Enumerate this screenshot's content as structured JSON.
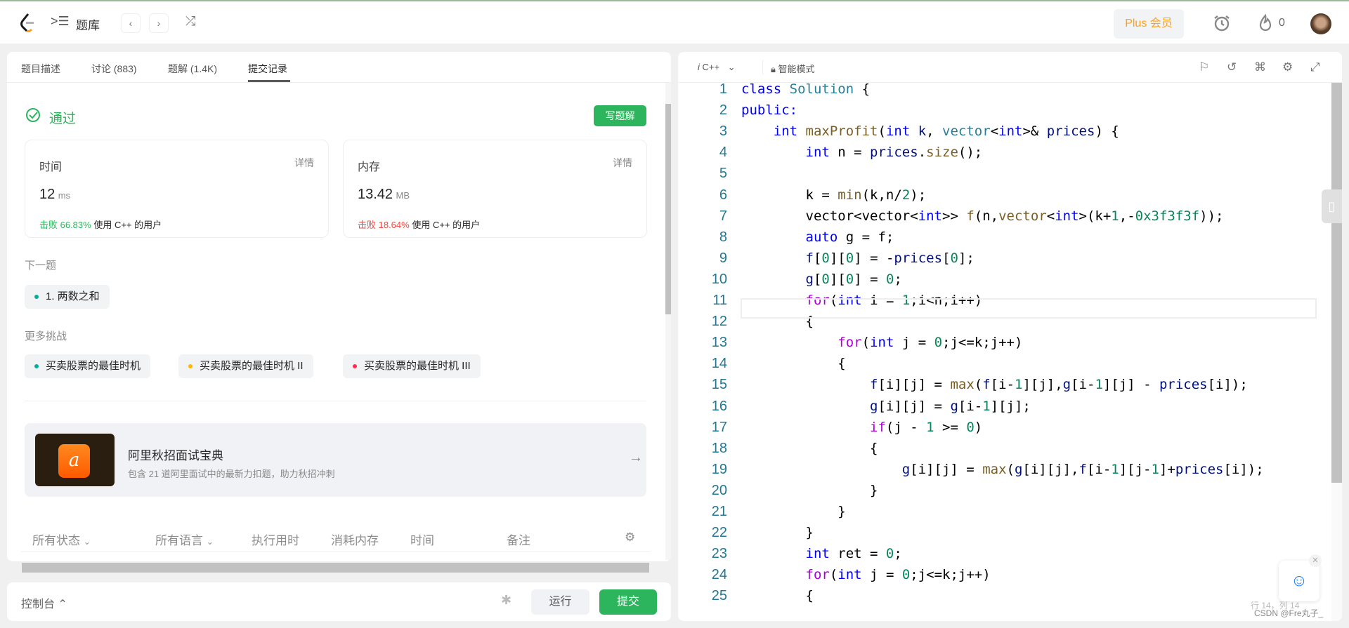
{
  "header": {
    "title": "题库",
    "prev": "‹",
    "next": "›",
    "plus_label": "Plus 会员",
    "streak": "0"
  },
  "left": {
    "tabs": [
      {
        "label": "题目描述"
      },
      {
        "label": "讨论 (883)"
      },
      {
        "label": "题解 (1.4K)"
      },
      {
        "label": "提交记录"
      }
    ],
    "status": "通过",
    "write_solution": "写题解",
    "time": {
      "title": "时间",
      "detail": "详情",
      "value": "12",
      "unit": "ms",
      "beat": "击败 66.83%",
      "suffix": "使用 C++ 的用户"
    },
    "memory": {
      "title": "内存",
      "detail": "详情",
      "value": "13.42",
      "unit": "MB",
      "beat": "击败 18.64%",
      "suffix": "使用 C++ 的用户"
    },
    "next_title": "下一题",
    "next_item": "1. 两数之和",
    "more_title": "更多挑战",
    "more_items": [
      {
        "label": "买卖股票的最佳时机",
        "color": "#00af9b"
      },
      {
        "label": "买卖股票的最佳时机 II",
        "color": "#ffb800"
      },
      {
        "label": "买卖股票的最佳时机 III",
        "color": "#ff2d55"
      }
    ],
    "promo": {
      "title": "阿里秋招面试宝典",
      "desc": "包含 21 道阿里面试中的最新力扣题，助力秋招冲刺"
    },
    "table_headers": [
      "所有状态",
      "所有语言",
      "执行用时",
      "消耗内存",
      "时间",
      "备注"
    ]
  },
  "bottom": {
    "console": "控制台",
    "run": "运行",
    "submit": "提交"
  },
  "editor": {
    "language": "C++",
    "mode": "智能模式",
    "cursor": "行 14，列 14",
    "watermark": "CSDN @Fre丸子_",
    "lines": [
      [
        [
          "class ",
          "kw"
        ],
        [
          "Solution",
          "ty"
        ],
        [
          " {",
          ""
        ]
      ],
      [
        [
          "public:",
          "kw"
        ]
      ],
      [
        [
          "    ",
          ""
        ],
        [
          "int ",
          "kw"
        ],
        [
          "maxProfit",
          "fn"
        ],
        [
          "(",
          ""
        ],
        [
          "int ",
          "kw"
        ],
        [
          "k",
          "var"
        ],
        [
          ", ",
          ""
        ],
        [
          "vector",
          "ty"
        ],
        [
          "<",
          ""
        ],
        [
          "int",
          "kw"
        ],
        [
          ">& ",
          ""
        ],
        [
          "prices",
          "var"
        ],
        [
          ") {",
          ""
        ]
      ],
      [
        [
          "        ",
          ""
        ],
        [
          "int ",
          "kw"
        ],
        [
          "n = ",
          ""
        ],
        [
          "prices",
          "var"
        ],
        [
          ".",
          ""
        ],
        [
          "size",
          "fn"
        ],
        [
          "();",
          ""
        ]
      ],
      [
        [
          "",
          ""
        ]
      ],
      [
        [
          "        k = ",
          ""
        ],
        [
          "min",
          "fn"
        ],
        [
          "(k,n/",
          ""
        ],
        [
          "2",
          "num"
        ],
        [
          ");",
          ""
        ]
      ],
      [
        [
          "        vector<vector<",
          ""
        ],
        [
          "int",
          "kw"
        ],
        [
          ">> ",
          ""
        ],
        [
          "f",
          "fn"
        ],
        [
          "(n,",
          ""
        ],
        [
          "vector",
          "fn"
        ],
        [
          "<",
          ""
        ],
        [
          "int",
          "kw"
        ],
        [
          ">(k+",
          ""
        ],
        [
          "1",
          "num"
        ],
        [
          ",-",
          ""
        ],
        [
          "0x3f3f3f",
          "num"
        ],
        [
          "));",
          ""
        ]
      ],
      [
        [
          "        ",
          ""
        ],
        [
          "auto ",
          "kw"
        ],
        [
          "g = f;",
          ""
        ]
      ],
      [
        [
          "        ",
          ""
        ],
        [
          "f",
          "var"
        ],
        [
          "[",
          ""
        ],
        [
          "0",
          "num"
        ],
        [
          "][",
          ""
        ],
        [
          "0",
          "num"
        ],
        [
          "] = -",
          ""
        ],
        [
          "prices",
          "var"
        ],
        [
          "[",
          ""
        ],
        [
          "0",
          "num"
        ],
        [
          "];",
          ""
        ]
      ],
      [
        [
          "        ",
          ""
        ],
        [
          "g",
          "var"
        ],
        [
          "[",
          ""
        ],
        [
          "0",
          "num"
        ],
        [
          "][",
          ""
        ],
        [
          "0",
          "num"
        ],
        [
          "] = ",
          ""
        ],
        [
          "0",
          "num"
        ],
        [
          ";",
          ""
        ]
      ],
      [
        [
          "        ",
          ""
        ],
        [
          "for",
          "ctl"
        ],
        [
          "(",
          ""
        ],
        [
          "int ",
          "kw"
        ],
        [
          "i = ",
          ""
        ],
        [
          "1",
          "num"
        ],
        [
          ";i<n;i++)",
          ""
        ]
      ],
      [
        [
          "        {",
          ""
        ]
      ],
      [
        [
          "            ",
          ""
        ],
        [
          "for",
          "ctl"
        ],
        [
          "(",
          ""
        ],
        [
          "int ",
          "kw"
        ],
        [
          "j = ",
          ""
        ],
        [
          "0",
          "num"
        ],
        [
          ";j<=k;j++)",
          ""
        ]
      ],
      [
        [
          "            {",
          ""
        ]
      ],
      [
        [
          "                ",
          ""
        ],
        [
          "f",
          "var"
        ],
        [
          "[i][j] = ",
          ""
        ],
        [
          "max",
          "fn"
        ],
        [
          "(",
          ""
        ],
        [
          "f",
          "var"
        ],
        [
          "[i-",
          ""
        ],
        [
          "1",
          "num"
        ],
        [
          "][j],",
          ""
        ],
        [
          "g",
          "var"
        ],
        [
          "[i-",
          ""
        ],
        [
          "1",
          "num"
        ],
        [
          "][j] - ",
          ""
        ],
        [
          "prices",
          "var"
        ],
        [
          "[i]);",
          ""
        ]
      ],
      [
        [
          "                ",
          ""
        ],
        [
          "g",
          "var"
        ],
        [
          "[i][j] = ",
          ""
        ],
        [
          "g",
          "var"
        ],
        [
          "[i-",
          ""
        ],
        [
          "1",
          "num"
        ],
        [
          "][j];",
          ""
        ]
      ],
      [
        [
          "                ",
          ""
        ],
        [
          "if",
          "ctl"
        ],
        [
          "(j - ",
          ""
        ],
        [
          "1",
          "num"
        ],
        [
          " >= ",
          ""
        ],
        [
          "0",
          "num"
        ],
        [
          ")",
          ""
        ]
      ],
      [
        [
          "                {",
          ""
        ]
      ],
      [
        [
          "                    ",
          ""
        ],
        [
          "g",
          "var"
        ],
        [
          "[i][j] = ",
          ""
        ],
        [
          "max",
          "fn"
        ],
        [
          "(",
          ""
        ],
        [
          "g",
          "var"
        ],
        [
          "[i][j],",
          ""
        ],
        [
          "f",
          "var"
        ],
        [
          "[i-",
          ""
        ],
        [
          "1",
          "num"
        ],
        [
          "][j-",
          ""
        ],
        [
          "1",
          "num"
        ],
        [
          "]+",
          ""
        ],
        [
          "prices",
          "var"
        ],
        [
          "[i]);",
          ""
        ]
      ],
      [
        [
          "                }",
          ""
        ]
      ],
      [
        [
          "            }",
          ""
        ]
      ],
      [
        [
          "        }",
          ""
        ]
      ],
      [
        [
          "        ",
          ""
        ],
        [
          "int ",
          "kw"
        ],
        [
          "ret = ",
          ""
        ],
        [
          "0",
          "num"
        ],
        [
          ";",
          ""
        ]
      ],
      [
        [
          "        ",
          ""
        ],
        [
          "for",
          "ctl"
        ],
        [
          "(",
          ""
        ],
        [
          "int ",
          "kw"
        ],
        [
          "j = ",
          ""
        ],
        [
          "0",
          "num"
        ],
        [
          ";j<=k;j++)",
          ""
        ]
      ],
      [
        [
          "        {",
          ""
        ]
      ]
    ]
  }
}
